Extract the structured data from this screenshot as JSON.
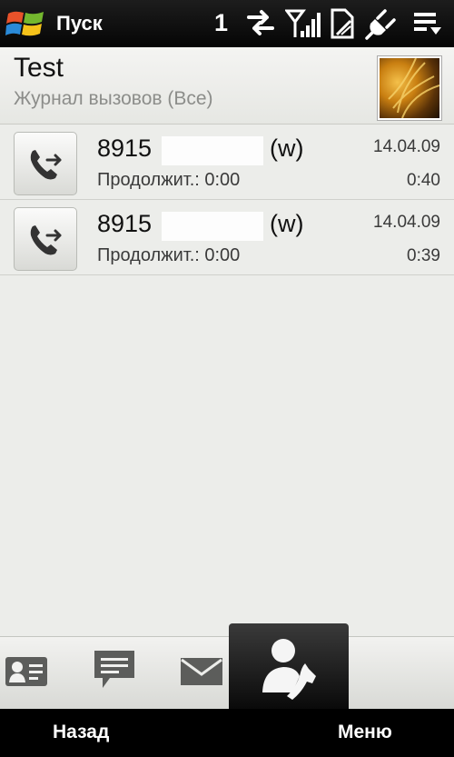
{
  "status_bar": {
    "start_label": "Пуск",
    "notification_count": "1",
    "icons": [
      "windows-logo-icon",
      "data-transfer-icon",
      "signal-strength-icon",
      "no-sim-icon",
      "power-plug-icon",
      "menu-sort-icon"
    ]
  },
  "header": {
    "contact_name": "Test",
    "subtitle": "Журнал вызовов (Все)"
  },
  "calls": [
    {
      "number": "8915",
      "type": "(w)",
      "duration": "Продолжит.: 0:00",
      "date": "14.04.09",
      "time": "0:40",
      "icon": "outgoing-call-icon"
    },
    {
      "number": "8915",
      "type": "(w)",
      "duration": "Продолжит.: 0:00",
      "date": "14.04.09",
      "time": "0:39",
      "icon": "outgoing-call-icon"
    }
  ],
  "tabs": [
    {
      "icon": "contact-card-icon",
      "active": false
    },
    {
      "icon": "sms-message-icon",
      "active": false
    },
    {
      "icon": "email-envelope-icon",
      "active": false
    },
    {
      "icon": "contact-call-history-icon",
      "active": true
    }
  ],
  "softkeys": {
    "left": "Назад",
    "right": "Меню"
  }
}
